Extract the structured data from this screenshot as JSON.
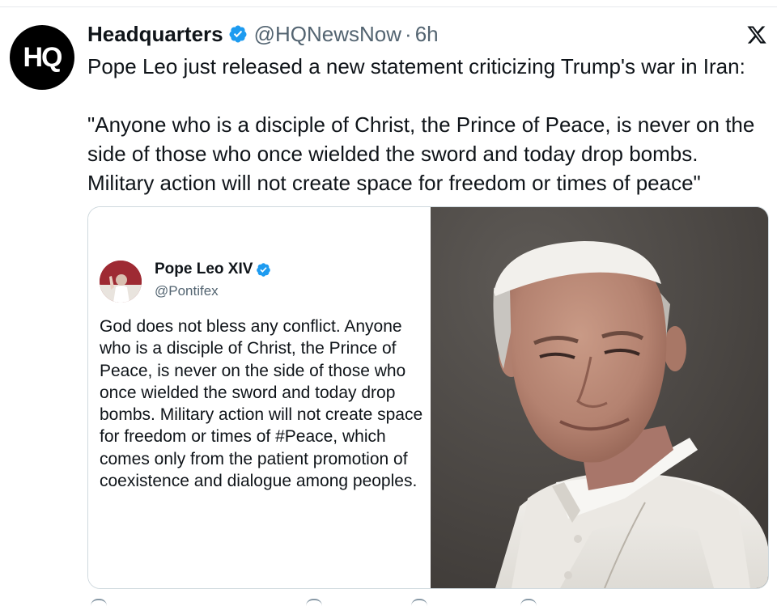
{
  "post": {
    "author_name": "Headquarters",
    "author_handle": "@HQNewsNow",
    "separator": "·",
    "time": "6h",
    "avatar_text": "HQ",
    "text": "Pope Leo just released a new statement criticizing Trump's war in Iran:\n\n\"Anyone who is a disciple of Christ, the Prince of Peace, is never on the side of those who once wielded the sword and today drop bombs. Military action will not create space for freedom or times of peace\""
  },
  "embedded": {
    "author_name": "Pope Leo XIV",
    "author_handle": "@Pontifex",
    "text": "God does not bless any conflict. Anyone who is a disciple of Christ, the Prince of Peace, is never on the side of those who once wielded the sword and today drop bombs. Military action will not create space for freedom or times of #Peace, which comes only from the patient promotion of coexistence and dialogue among peoples."
  },
  "icons": {
    "verified": "verified-badge-icon",
    "platform": "x-logo-icon"
  },
  "colors": {
    "verified_blue": "#1d9bf0",
    "text": "#0f1419",
    "secondary_text": "#536471"
  }
}
